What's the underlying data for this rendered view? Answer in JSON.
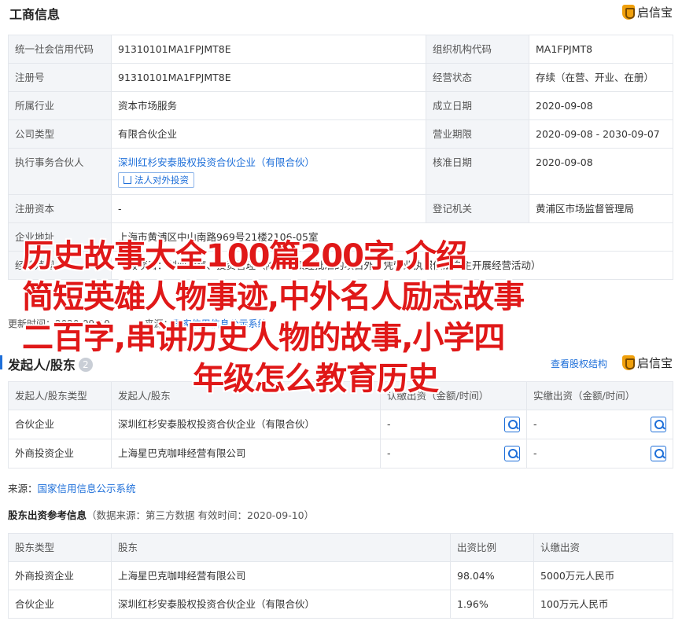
{
  "biz_section": {
    "title": "工商信息",
    "brand": "启信宝",
    "rows": [
      {
        "l1": "统一社会信用代码",
        "v1": "91310101MA1FPJMT8E",
        "l2": "组织机构代码",
        "v2": "MA1FPJMT8"
      },
      {
        "l1": "注册号",
        "v1": "91310101MA1FPJMT8E",
        "l2": "经营状态",
        "v2": "存续（在营、开业、在册）"
      },
      {
        "l1": "所属行业",
        "v1": "资本市场服务",
        "l2": "成立日期",
        "v2": "2020-09-08"
      },
      {
        "l1": "公司类型",
        "v1": "有限合伙企业",
        "l2": "营业期限",
        "v2": "2020-09-08 - 2030-09-07"
      },
      {
        "l1": "执行事务合伙人",
        "v1": "深圳红杉安泰股权投资合伙企业（有限合伙）",
        "v1_button": "法人对外投资",
        "l2": "核准日期",
        "v2": "2020-09-08"
      },
      {
        "l1": "注册资本",
        "v1": "-",
        "l2": "登记机关",
        "v2": "黄浦区市场监督管理局"
      },
      {
        "l1": "企业地址",
        "v1": "上海市黄浦区中山南路969号21楼2106-05室",
        "l2": "",
        "v2": ""
      },
      {
        "l1": "经营范围",
        "v1": "一般项目：创业投资、投资管理（除依法须经批准的项目外，凭营业执照依法自主开展经营活动）",
        "l2": "",
        "v2": ""
      }
    ],
    "update_label": "更新时间：",
    "update_time": "2020-09-10",
    "source_prefix": "来源：",
    "source_link": "国家信用信息公示系统"
  },
  "shareholder_section": {
    "title": "发起人/股东",
    "count": "2",
    "equity_link": "查看股权结构",
    "brand": "启信宝",
    "headers": [
      "发起人/股东类型",
      "发起人/股东",
      "认缴出资（金额/时间）",
      "实缴出资（金额/时间）"
    ],
    "rows": [
      {
        "type": "合伙企业",
        "name": "深圳红杉安泰股权投资合伙企业（有限合伙）",
        "subscribed": "-",
        "paid": "-"
      },
      {
        "type": "外商投资企业",
        "name": "上海星巴克咖啡经营有限公司",
        "subscribed": "-",
        "paid": "-"
      }
    ],
    "source_prefix": "来源：",
    "source_link": "国家信用信息公示系统"
  },
  "reference_section": {
    "title": "股东出资参考信息",
    "meta": "（数据来源：第三方数据 有效时间：2020-09-10）",
    "headers": [
      "股东类型",
      "股东",
      "出资比例",
      "认缴出资"
    ],
    "rows": [
      {
        "type": "外商投资企业",
        "name": "上海星巴克咖啡经营有限公司",
        "ratio": "98.04%",
        "amount": "5000万元人民币"
      },
      {
        "type": "合伙企业",
        "name": "深圳红杉安泰股权投资合伙企业（有限合伙）",
        "ratio": "1.96%",
        "amount": "100万元人民币"
      }
    ]
  },
  "overlay_text": {
    "line1": "历史故事大全100篇200字,介绍",
    "line2": "简短英雄人物事迹,中外名人励志故事",
    "line3": "二百字,串讲历史人物的故事,小学四",
    "line4": "年级怎么教育历史"
  },
  "colors": {
    "accent": "#1e6fd9",
    "overlay_red": "#e01818",
    "brand_gold": "#f0a00c"
  }
}
